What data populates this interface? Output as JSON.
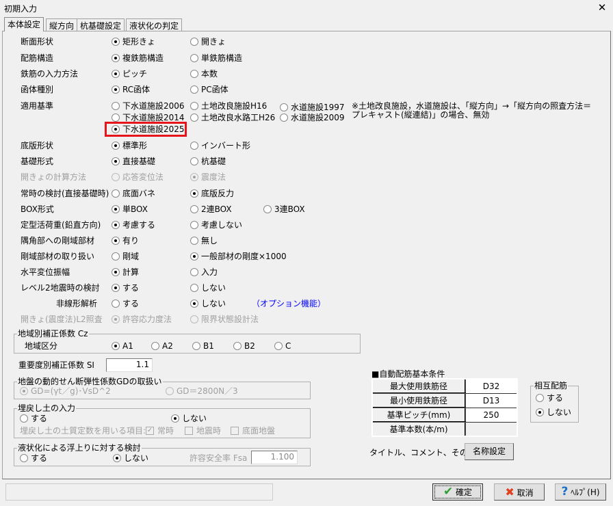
{
  "window": {
    "title": "初期入力",
    "close_icon": "close-icon"
  },
  "tabs": [
    {
      "label": "本体設定",
      "active": true
    },
    {
      "label": "縦方向"
    },
    {
      "label": "杭基礎設定"
    },
    {
      "label": "液状化の判定"
    }
  ],
  "rows": [
    {
      "label": "断面形状",
      "options": [
        {
          "label": "矩形きょ",
          "checked": true
        },
        {
          "label": "開きょ"
        }
      ]
    },
    {
      "label": "配筋構造",
      "options": [
        {
          "label": "複鉄筋構造",
          "checked": true
        },
        {
          "label": "単鉄筋構造"
        }
      ]
    },
    {
      "label": "鉄筋の入力方法",
      "options": [
        {
          "label": "ピッチ",
          "checked": true
        },
        {
          "label": "本数"
        }
      ]
    },
    {
      "label": "函体種別",
      "options": [
        {
          "label": "RC函体",
          "checked": true
        },
        {
          "label": "PC函体"
        }
      ]
    },
    {
      "label": "適用基準",
      "options": [
        {
          "label": "下水道施設2006"
        },
        {
          "label": "土地改良施設H16"
        },
        {
          "label": "水道施設1997"
        },
        {
          "label": "下水道施設2014"
        },
        {
          "label": "土地改良水路工H26"
        },
        {
          "label": "水道施設2009"
        },
        {
          "label": "下水道施設2025",
          "checked": true,
          "highlighted": true
        }
      ],
      "note": "※土地改良施設，水道施設は、「縦方向」→「縦方向の照査方法＝\nプレキャスト(縦連結)」の場合、無効"
    },
    {
      "label": "底版形状",
      "options": [
        {
          "label": "標準形",
          "checked": true
        },
        {
          "label": "インバート形"
        }
      ]
    },
    {
      "label": "基礎形式",
      "options": [
        {
          "label": "直接基礎",
          "checked": true
        },
        {
          "label": "杭基礎"
        }
      ]
    },
    {
      "label": "開きょの計算方法",
      "disabled": true,
      "options": [
        {
          "label": "応答変位法"
        },
        {
          "label": "震度法",
          "checked": true
        }
      ]
    },
    {
      "label": "常時の検討(直接基礎時)",
      "options": [
        {
          "label": "底面バネ"
        },
        {
          "label": "底版反力",
          "checked": true
        }
      ]
    },
    {
      "label": "BOX形式",
      "options": [
        {
          "label": "単BOX",
          "checked": true
        },
        {
          "label": "2連BOX"
        },
        {
          "label": "3連BOX"
        }
      ]
    },
    {
      "label": "定型活荷重(鉛直方向)",
      "options": [
        {
          "label": "考慮する",
          "checked": true
        },
        {
          "label": "考慮しない"
        }
      ]
    },
    {
      "label": "隅角部への剛域部材",
      "options": [
        {
          "label": "有り",
          "checked": true
        },
        {
          "label": "無し"
        }
      ]
    },
    {
      "label": "剛域部材の取り扱い",
      "options": [
        {
          "label": "剛域"
        },
        {
          "label": "一般部材の剛度×1000",
          "checked": true
        }
      ]
    },
    {
      "label": "水平変位振幅",
      "options": [
        {
          "label": "計算",
          "checked": true
        },
        {
          "label": "入力"
        }
      ]
    },
    {
      "label": "レベル2地震時の検討",
      "options": [
        {
          "label": "する",
          "checked": true
        },
        {
          "label": "しない"
        }
      ]
    },
    {
      "label": "非線形解析",
      "indent": true,
      "options": [
        {
          "label": "する"
        },
        {
          "label": "しない",
          "checked": true
        }
      ],
      "link": "（オプション機能）"
    },
    {
      "label": "開きょ(震度法)L2照査",
      "disabled": true,
      "options": [
        {
          "label": "許容応力度法",
          "checked": true
        },
        {
          "label": "限界状態設計法"
        }
      ]
    }
  ],
  "region": {
    "title": "地域別補正係数 Cz",
    "label": "地域区分",
    "options": [
      {
        "label": "A1",
        "checked": true
      },
      {
        "label": "A2"
      },
      {
        "label": "B1"
      },
      {
        "label": "B2"
      },
      {
        "label": "C"
      }
    ]
  },
  "importance": {
    "label": "重要度別補正係数 SI",
    "value": "1.1"
  },
  "gd": {
    "title": "地盤の動的せん断弾性係数GDの取扱い",
    "options": [
      {
        "label": "GD=(γt／g)･VsD^2",
        "checked": true
      },
      {
        "label": "GD＝2800N／3"
      }
    ]
  },
  "backfill": {
    "title": "埋戻し土の入力",
    "options": [
      {
        "label": "する"
      },
      {
        "label": "しない",
        "checked": true
      }
    ],
    "items_label": "埋戻し土の土質定数を用いる項目:",
    "checks": [
      {
        "label": "常時",
        "checked": true
      },
      {
        "label": "地震時",
        "checked": false
      },
      {
        "label": "底面地盤",
        "checked": false
      }
    ]
  },
  "liquefaction": {
    "title": "液状化による浮上りに対する検討",
    "options": [
      {
        "label": "する"
      },
      {
        "label": "しない",
        "checked": true
      }
    ],
    "fsa_label": "許容安全率 Fsa",
    "fsa_value": "1.100"
  },
  "auto": {
    "title": "■自動配筋基本条件",
    "rows": [
      {
        "label": "最大使用鉄筋径",
        "value": "D32"
      },
      {
        "label": "最小使用鉄筋径",
        "value": "D13"
      },
      {
        "label": "基準ピッチ(mm)",
        "value": "250"
      },
      {
        "label": "基準本数(本/m)",
        "value": ""
      }
    ]
  },
  "mutual": {
    "title": "相互配筋",
    "options": [
      {
        "label": "する"
      },
      {
        "label": "しない",
        "checked": true
      }
    ]
  },
  "naming": {
    "label": "タイトル、コメント、その他:",
    "button": "名称設定"
  },
  "footer": {
    "status": "",
    "ok": "確定",
    "cancel": "取消",
    "help": "ﾍﾙﾌﾟ(H)"
  },
  "colors": {
    "highlight": "#e8141c",
    "link": "#0000ff",
    "ok_icon": "#2e9e2e",
    "cancel_icon": "#e0401e",
    "help_icon": "#1a6fc9"
  }
}
